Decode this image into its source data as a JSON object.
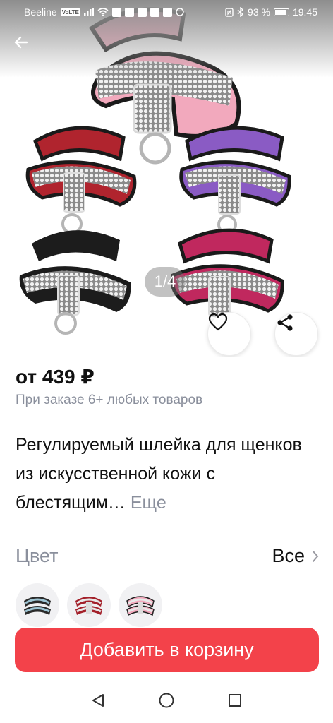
{
  "status_bar": {
    "carrier": "Beeline",
    "network_badge": "VoLTE",
    "battery": "93 %",
    "time": "19:45"
  },
  "gallery": {
    "page_indicator": "1/4",
    "icons": {
      "back": "arrow-left-icon",
      "favorite": "heart-icon",
      "share": "share-icon"
    }
  },
  "product": {
    "price": "от 439 ₽",
    "promo": "При заказе 6+ любых товаров",
    "title": "Регулируемый шлейка для щенков из искусственной кожи с блестящим…",
    "more_link": "Еще"
  },
  "variants": {
    "label": "Цвет",
    "all_label": "Все",
    "thumbs": [
      {
        "color": "black-silver"
      },
      {
        "color": "red"
      },
      {
        "color": "pink"
      }
    ]
  },
  "actions": {
    "add_to_cart": "Добавить в корзину",
    "accent_color": "#f3424a"
  },
  "nav": {
    "icons": [
      "triangle-back-icon",
      "circle-home-icon",
      "square-recents-icon"
    ]
  }
}
